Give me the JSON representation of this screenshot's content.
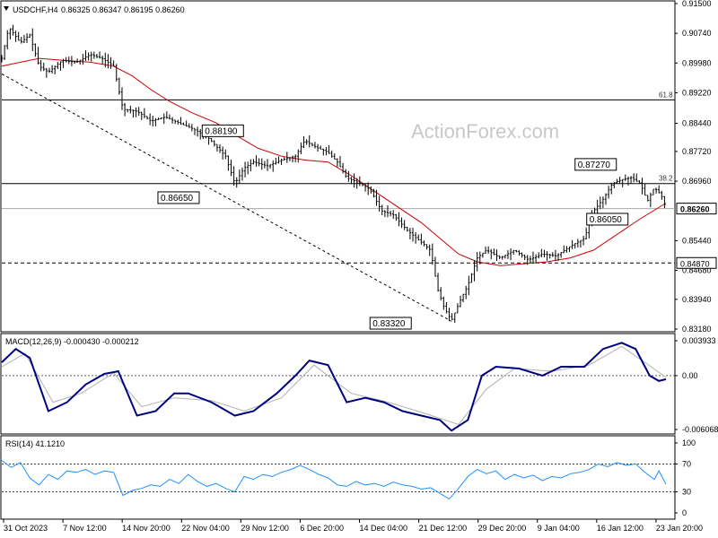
{
  "header": {
    "symbol": "USDCHF,H4",
    "ohlc": "0.86325 0.86347 0.86195 0.86260"
  },
  "watermark": "ActionForex.com",
  "chart_data": [
    {
      "type": "candlestick",
      "pane": "price",
      "symbol": "USDCHF",
      "timeframe": "H4",
      "ylim": [
        0.8318,
        0.915
      ],
      "y_ticks": [
        "0.91500",
        "0.90740",
        "0.89980",
        "0.89220",
        "0.88440",
        "0.87720",
        "0.86960",
        "0.86260",
        "0.85440",
        "0.84680",
        "0.83940",
        "0.83180"
      ],
      "x_ticks": [
        "31 Oct 2023",
        "7 Nov 12:00",
        "14 Nov 20:00",
        "22 Nov 04:00",
        "29 Nov 12:00",
        "6 Dec 20:00",
        "14 Dec 04:00",
        "21 Dec 12:00",
        "29 Dec 20:00",
        "9 Jan 04:00",
        "16 Jan 12:00",
        "23 Jan 20:00"
      ],
      "current_price": "0.86260",
      "support_price": "0.84870",
      "fibonacci": [
        {
          "label": "61.8",
          "value": 0.8904
        },
        {
          "label": "38.2",
          "value": 0.869
        }
      ],
      "price_labels": [
        "0.88190",
        "0.86650",
        "0.87270",
        "0.86050",
        "0.83320"
      ],
      "price_series": [
        {
          "t": 0,
          "v": 0.901
        },
        {
          "t": 3,
          "v": 0.909
        },
        {
          "t": 8,
          "v": 0.905
        },
        {
          "t": 12,
          "v": 0.907
        },
        {
          "t": 16,
          "v": 0.899
        },
        {
          "t": 20,
          "v": 0.8975
        },
        {
          "t": 26,
          "v": 0.9005
        },
        {
          "t": 32,
          "v": 0.9
        },
        {
          "t": 38,
          "v": 0.902
        },
        {
          "t": 43,
          "v": 0.901
        },
        {
          "t": 48,
          "v": 0.899
        },
        {
          "t": 52,
          "v": 0.888
        },
        {
          "t": 58,
          "v": 0.8875
        },
        {
          "t": 64,
          "v": 0.885
        },
        {
          "t": 70,
          "v": 0.886
        },
        {
          "t": 76,
          "v": 0.8845
        },
        {
          "t": 82,
          "v": 0.883
        },
        {
          "t": 88,
          "v": 0.881
        },
        {
          "t": 92,
          "v": 0.8785
        },
        {
          "t": 96,
          "v": 0.876
        },
        {
          "t": 100,
          "v": 0.869
        },
        {
          "t": 104,
          "v": 0.873
        },
        {
          "t": 108,
          "v": 0.8745
        },
        {
          "t": 114,
          "v": 0.8735
        },
        {
          "t": 120,
          "v": 0.875
        },
        {
          "t": 126,
          "v": 0.876
        },
        {
          "t": 130,
          "v": 0.88
        },
        {
          "t": 134,
          "v": 0.8785
        },
        {
          "t": 140,
          "v": 0.877
        },
        {
          "t": 144,
          "v": 0.8745
        },
        {
          "t": 148,
          "v": 0.8705
        },
        {
          "t": 154,
          "v": 0.869
        },
        {
          "t": 158,
          "v": 0.8675
        },
        {
          "t": 163,
          "v": 0.862
        },
        {
          "t": 168,
          "v": 0.861
        },
        {
          "t": 174,
          "v": 0.857
        },
        {
          "t": 178,
          "v": 0.855
        },
        {
          "t": 184,
          "v": 0.852
        },
        {
          "t": 187,
          "v": 0.842
        },
        {
          "t": 190,
          "v": 0.837
        },
        {
          "t": 193,
          "v": 0.834
        },
        {
          "t": 197,
          "v": 0.8395
        },
        {
          "t": 200,
          "v": 0.843
        },
        {
          "t": 204,
          "v": 0.85
        },
        {
          "t": 208,
          "v": 0.852
        },
        {
          "t": 214,
          "v": 0.85
        },
        {
          "t": 220,
          "v": 0.852
        },
        {
          "t": 226,
          "v": 0.8495
        },
        {
          "t": 232,
          "v": 0.851
        },
        {
          "t": 238,
          "v": 0.8505
        },
        {
          "t": 244,
          "v": 0.853
        },
        {
          "t": 250,
          "v": 0.855
        },
        {
          "t": 254,
          "v": 0.862
        },
        {
          "t": 258,
          "v": 0.865
        },
        {
          "t": 262,
          "v": 0.869
        },
        {
          "t": 266,
          "v": 0.87
        },
        {
          "t": 270,
          "v": 0.8705
        },
        {
          "t": 274,
          "v": 0.869
        },
        {
          "t": 277,
          "v": 0.8645
        },
        {
          "t": 280,
          "v": 0.868
        },
        {
          "t": 283,
          "v": 0.866
        },
        {
          "t": 285,
          "v": 0.8626
        }
      ],
      "sma_series": [
        {
          "t": 0,
          "v": 0.899
        },
        {
          "t": 8,
          "v": 0.9
        },
        {
          "t": 16,
          "v": 0.901
        },
        {
          "t": 26,
          "v": 0.9005
        },
        {
          "t": 38,
          "v": 0.9
        },
        {
          "t": 48,
          "v": 0.899
        },
        {
          "t": 56,
          "v": 0.8965
        },
        {
          "t": 64,
          "v": 0.893
        },
        {
          "t": 72,
          "v": 0.89
        },
        {
          "t": 82,
          "v": 0.887
        },
        {
          "t": 92,
          "v": 0.8845
        },
        {
          "t": 100,
          "v": 0.8815
        },
        {
          "t": 110,
          "v": 0.878
        },
        {
          "t": 120,
          "v": 0.876
        },
        {
          "t": 130,
          "v": 0.875
        },
        {
          "t": 140,
          "v": 0.8745
        },
        {
          "t": 150,
          "v": 0.871
        },
        {
          "t": 160,
          "v": 0.867
        },
        {
          "t": 170,
          "v": 0.863
        },
        {
          "t": 180,
          "v": 0.859
        },
        {
          "t": 188,
          "v": 0.855
        },
        {
          "t": 196,
          "v": 0.851
        },
        {
          "t": 204,
          "v": 0.849
        },
        {
          "t": 214,
          "v": 0.848
        },
        {
          "t": 224,
          "v": 0.8485
        },
        {
          "t": 234,
          "v": 0.849
        },
        {
          "t": 244,
          "v": 0.85
        },
        {
          "t": 254,
          "v": 0.852
        },
        {
          "t": 264,
          "v": 0.856
        },
        {
          "t": 274,
          "v": 0.86
        },
        {
          "t": 285,
          "v": 0.864
        }
      ],
      "trendline": [
        {
          "t": 0,
          "v": 0.897
        },
        {
          "t": 193,
          "v": 0.8338
        }
      ]
    },
    {
      "type": "line",
      "pane": "macd",
      "title": "MACD(12,26,9) -0.000430 -0.000212",
      "ylim": [
        -0.006068,
        0.003933
      ],
      "y_ticks": [
        "0.003933",
        "0.00",
        "-0.006068"
      ],
      "macd_series": [
        {
          "t": 0,
          "v": 0.0015
        },
        {
          "t": 6,
          "v": 0.003
        },
        {
          "t": 12,
          "v": 0.002
        },
        {
          "t": 20,
          "v": -0.004
        },
        {
          "t": 28,
          "v": -0.003
        },
        {
          "t": 36,
          "v": -0.001
        },
        {
          "t": 44,
          "v": 0.0002
        },
        {
          "t": 50,
          "v": 0.0005
        },
        {
          "t": 58,
          "v": -0.0045
        },
        {
          "t": 66,
          "v": -0.004
        },
        {
          "t": 74,
          "v": -0.002
        },
        {
          "t": 80,
          "v": -0.002
        },
        {
          "t": 90,
          "v": -0.003
        },
        {
          "t": 100,
          "v": -0.0045
        },
        {
          "t": 108,
          "v": -0.004
        },
        {
          "t": 118,
          "v": -0.002
        },
        {
          "t": 126,
          "v": 0.0
        },
        {
          "t": 132,
          "v": 0.0017
        },
        {
          "t": 140,
          "v": 0.0012
        },
        {
          "t": 148,
          "v": -0.003
        },
        {
          "t": 156,
          "v": -0.0025
        },
        {
          "t": 164,
          "v": -0.003
        },
        {
          "t": 172,
          "v": -0.004
        },
        {
          "t": 180,
          "v": -0.0045
        },
        {
          "t": 188,
          "v": -0.005
        },
        {
          "t": 193,
          "v": -0.0062
        },
        {
          "t": 200,
          "v": -0.005
        },
        {
          "t": 206,
          "v": 0.0
        },
        {
          "t": 212,
          "v": 0.001
        },
        {
          "t": 222,
          "v": 0.0008
        },
        {
          "t": 232,
          "v": 0.0
        },
        {
          "t": 240,
          "v": 0.001
        },
        {
          "t": 250,
          "v": 0.001
        },
        {
          "t": 258,
          "v": 0.003
        },
        {
          "t": 266,
          "v": 0.0037
        },
        {
          "t": 272,
          "v": 0.003
        },
        {
          "t": 278,
          "v": 0.0
        },
        {
          "t": 282,
          "v": -0.0006
        },
        {
          "t": 285,
          "v": -0.0004
        }
      ],
      "signal_series": [
        {
          "t": 0,
          "v": 0.001
        },
        {
          "t": 10,
          "v": 0.0025
        },
        {
          "t": 22,
          "v": -0.003
        },
        {
          "t": 34,
          "v": -0.002
        },
        {
          "t": 48,
          "v": 0.0003
        },
        {
          "t": 60,
          "v": -0.0035
        },
        {
          "t": 74,
          "v": -0.0025
        },
        {
          "t": 90,
          "v": -0.0028
        },
        {
          "t": 104,
          "v": -0.004
        },
        {
          "t": 120,
          "v": -0.0025
        },
        {
          "t": 134,
          "v": 0.0012
        },
        {
          "t": 150,
          "v": -0.002
        },
        {
          "t": 166,
          "v": -0.003
        },
        {
          "t": 182,
          "v": -0.0043
        },
        {
          "t": 196,
          "v": -0.0055
        },
        {
          "t": 208,
          "v": -0.0015
        },
        {
          "t": 220,
          "v": 0.0008
        },
        {
          "t": 236,
          "v": 0.0005
        },
        {
          "t": 252,
          "v": 0.0012
        },
        {
          "t": 266,
          "v": 0.0033
        },
        {
          "t": 276,
          "v": 0.0015
        },
        {
          "t": 285,
          "v": -0.0002
        }
      ]
    },
    {
      "type": "line",
      "pane": "rsi",
      "title": "RSI(14) 41.1210",
      "ylim": [
        0,
        100
      ],
      "y_ticks": [
        "100",
        "70",
        "30",
        "0"
      ],
      "levels": [
        70,
        30
      ],
      "rsi_series": [
        {
          "t": 0,
          "v": 75
        },
        {
          "t": 4,
          "v": 65
        },
        {
          "t": 8,
          "v": 72
        },
        {
          "t": 12,
          "v": 50
        },
        {
          "t": 16,
          "v": 40
        },
        {
          "t": 20,
          "v": 55
        },
        {
          "t": 24,
          "v": 48
        },
        {
          "t": 28,
          "v": 60
        },
        {
          "t": 32,
          "v": 58
        },
        {
          "t": 36,
          "v": 62
        },
        {
          "t": 40,
          "v": 55
        },
        {
          "t": 44,
          "v": 60
        },
        {
          "t": 48,
          "v": 58
        },
        {
          "t": 52,
          "v": 25
        },
        {
          "t": 56,
          "v": 32
        },
        {
          "t": 60,
          "v": 35
        },
        {
          "t": 64,
          "v": 40
        },
        {
          "t": 68,
          "v": 38
        },
        {
          "t": 72,
          "v": 48
        },
        {
          "t": 76,
          "v": 42
        },
        {
          "t": 80,
          "v": 55
        },
        {
          "t": 84,
          "v": 45
        },
        {
          "t": 88,
          "v": 38
        },
        {
          "t": 92,
          "v": 42
        },
        {
          "t": 96,
          "v": 35
        },
        {
          "t": 100,
          "v": 30
        },
        {
          "t": 104,
          "v": 52
        },
        {
          "t": 108,
          "v": 48
        },
        {
          "t": 112,
          "v": 55
        },
        {
          "t": 116,
          "v": 52
        },
        {
          "t": 120,
          "v": 58
        },
        {
          "t": 124,
          "v": 62
        },
        {
          "t": 128,
          "v": 68
        },
        {
          "t": 132,
          "v": 62
        },
        {
          "t": 136,
          "v": 55
        },
        {
          "t": 140,
          "v": 50
        },
        {
          "t": 144,
          "v": 40
        },
        {
          "t": 148,
          "v": 38
        },
        {
          "t": 152,
          "v": 45
        },
        {
          "t": 156,
          "v": 40
        },
        {
          "t": 160,
          "v": 42
        },
        {
          "t": 164,
          "v": 38
        },
        {
          "t": 168,
          "v": 44
        },
        {
          "t": 172,
          "v": 40
        },
        {
          "t": 176,
          "v": 38
        },
        {
          "t": 180,
          "v": 34
        },
        {
          "t": 184,
          "v": 36
        },
        {
          "t": 188,
          "v": 28
        },
        {
          "t": 192,
          "v": 20
        },
        {
          "t": 196,
          "v": 35
        },
        {
          "t": 200,
          "v": 52
        },
        {
          "t": 204,
          "v": 62
        },
        {
          "t": 208,
          "v": 56
        },
        {
          "t": 212,
          "v": 60
        },
        {
          "t": 216,
          "v": 48
        },
        {
          "t": 220,
          "v": 55
        },
        {
          "t": 224,
          "v": 50
        },
        {
          "t": 228,
          "v": 54
        },
        {
          "t": 232,
          "v": 46
        },
        {
          "t": 236,
          "v": 52
        },
        {
          "t": 240,
          "v": 50
        },
        {
          "t": 244,
          "v": 56
        },
        {
          "t": 248,
          "v": 58
        },
        {
          "t": 252,
          "v": 62
        },
        {
          "t": 256,
          "v": 70
        },
        {
          "t": 260,
          "v": 66
        },
        {
          "t": 264,
          "v": 72
        },
        {
          "t": 268,
          "v": 68
        },
        {
          "t": 272,
          "v": 70
        },
        {
          "t": 276,
          "v": 58
        },
        {
          "t": 280,
          "v": 48
        },
        {
          "t": 282,
          "v": 60
        },
        {
          "t": 285,
          "v": 41
        }
      ]
    }
  ],
  "colors": {
    "candles": "#000000",
    "sma": "#cc0000",
    "macd": "#000080",
    "signal": "#b0b0b0",
    "rsi": "#1e90ff",
    "grid_dash": "#000000",
    "trendline": "#000000"
  }
}
